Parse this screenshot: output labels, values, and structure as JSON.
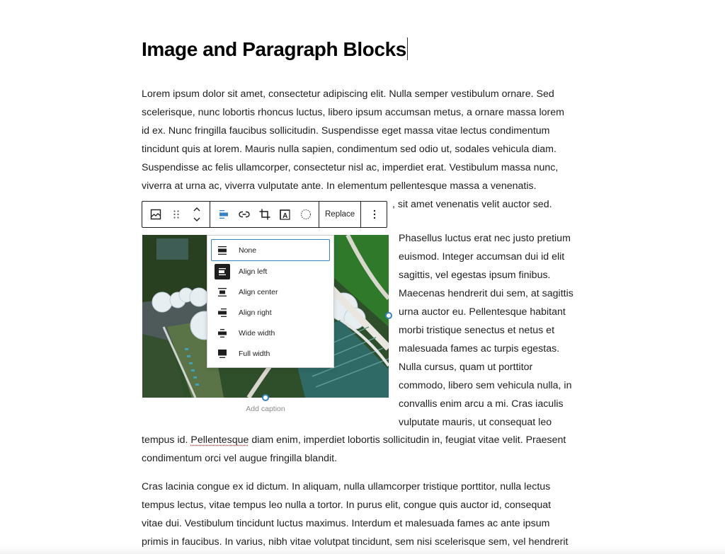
{
  "document": {
    "title": "Image and Paragraph Blocks"
  },
  "paragraph1": {
    "lines": [
      "Lorem ipsum dolor sit amet, consectetur adipiscing elit. Nulla semper vestibulum ornare. Sed",
      "scelerisque, nunc lobortis rhoncus luctus, libero ipsum accumsan metus, a ornare massa lorem",
      "id ex. Nunc fringilla faucibus sollicitudin. Suspendisse eget massa vitae lectus condimentum",
      "tincidunt quis at lorem. Mauris nulla sapien, condimentum sed odio ut, sodales vehicula diam.",
      "Suspendisse ac felis ullamcorper, consectetur nisl ac, imperdiet erat. Vestibulum massa nunc,",
      "viverra at urna ac, viverra vulputate ante. In elementum pellentesque massa a venenatis."
    ],
    "last_line_visible": ", sit amet venenatis velit auctor sed."
  },
  "toolbar": {
    "buttons": [
      {
        "name": "block-type-image",
        "icon": "image-icon",
        "label": "Image"
      },
      {
        "name": "drag-handle",
        "icon": "drag-icon",
        "label": "Drag"
      },
      {
        "name": "move-up-down",
        "icon": "chevron-up-down-icon",
        "label": "Move"
      },
      {
        "name": "align",
        "icon": "align-icon",
        "label": "Align"
      },
      {
        "name": "link",
        "icon": "link-icon",
        "label": "Insert link"
      },
      {
        "name": "crop",
        "icon": "crop-icon",
        "label": "Crop"
      },
      {
        "name": "text-overlay",
        "icon": "text-overlay-icon",
        "label": "Add text over image"
      },
      {
        "name": "duotone",
        "icon": "duotone-icon",
        "label": "Apply duotone filter"
      }
    ],
    "replace_label": "Replace",
    "more_icon": "more-vertical-icon",
    "accent_color": "#3582c4"
  },
  "align_menu": {
    "items": [
      {
        "label": "None",
        "icon": "align-none-icon",
        "selected": true
      },
      {
        "label": "Align left",
        "icon": "align-left-icon",
        "hovered": true
      },
      {
        "label": "Align center",
        "icon": "align-center-icon"
      },
      {
        "label": "Align right",
        "icon": "align-right-icon"
      },
      {
        "label": "Wide width",
        "icon": "align-wide-icon"
      },
      {
        "label": "Full width",
        "icon": "align-full-icon"
      }
    ]
  },
  "image_block": {
    "caption_placeholder": "Add caption"
  },
  "paragraph2": {
    "float_lines": [
      "Phasellus luctus erat nec justo pretium",
      "euismod. Integer accumsan dui id elit",
      "sagittis, vel egestas ipsum finibus.",
      "Maecenas hendrerit dui sem, at sagittis",
      "urna auctor eu. Pellentesque habitant",
      "morbi tristique senectus et netus et",
      "malesuada fames ac turpis egestas.",
      "Nulla cursus, quam ut porttitor",
      "commodo, libero sem vehicula nulla, in",
      "convallis enim arcu a mi. Cras iaculis",
      "vulputate mauris, ut consequat leo"
    ],
    "tail_line1_before": "tempus id. ",
    "tail_line1_misspelled": "Pellentesque",
    "tail_line1_after": " diam enim, imperdiet lobortis sollicitudin in, feugiat vitae velit. Praesent",
    "tail_line2": "condimentum orci vel augue fringilla blandit."
  },
  "paragraph3": {
    "lines": [
      "Cras lacinia congue ex id dictum. In aliquam, nulla ullamcorper tristique porttitor, nulla lectus",
      "tempus lectus, vitae tempus leo nulla a tortor. In purus elit, congue quis auctor id, consequat",
      "vitae dui. Vestibulum tincidunt luctus maximus. Interdum et malesuada fames ac ante ipsum",
      "primis in faucibus. In varius, nibh vitae volutpat tincidunt, sem nisi scelerisque sem, vel hendrerit"
    ]
  }
}
